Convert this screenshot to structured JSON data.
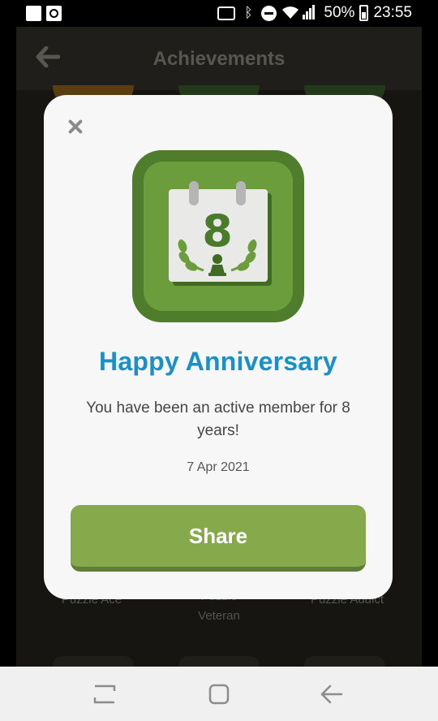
{
  "status_bar": {
    "battery_text": "50%",
    "time": "23:55",
    "icons": [
      "notification-square-icon",
      "notification-ring-icon",
      "cast-icon",
      "bluetooth-icon",
      "do-not-disturb-icon",
      "wifi-icon",
      "signal-icon",
      "battery-icon"
    ]
  },
  "app": {
    "title": "Achievements",
    "back_icon": "back-arrow-icon",
    "bg_labels": [
      "Puzzle Ace",
      "Puzzle\nVeteran",
      "Puzzle Addict"
    ]
  },
  "dialog": {
    "badge": {
      "number": "8",
      "icon": "anniversary-calendar-icon",
      "colors": {
        "outer": "#4f7d2c",
        "inner": "#6c9d3c",
        "page": "#e9e9e7",
        "accent": "#4a7a2b"
      }
    },
    "title": "Happy Anniversary",
    "message": "You have been an active member for 8 years!",
    "date": "7 Apr 2021",
    "share_label": "Share",
    "colors": {
      "title": "#1a8fc8",
      "button": "#85a94b"
    }
  },
  "nav_bar": {
    "buttons": [
      "recent-apps-icon",
      "home-icon",
      "back-icon"
    ]
  }
}
